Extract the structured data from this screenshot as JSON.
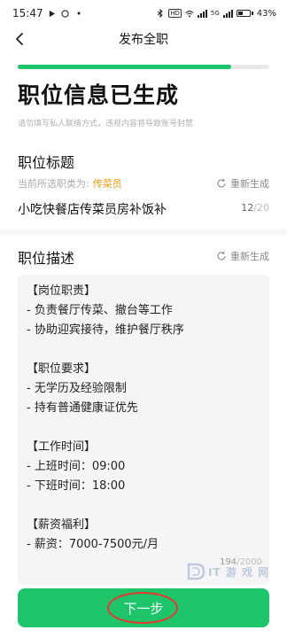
{
  "status_bar": {
    "time": "15:47",
    "network_badge_1": "HD",
    "network_badge_2": "5G",
    "battery": "43%"
  },
  "nav": {
    "title": "发布全职"
  },
  "progress": {
    "value": 0.85
  },
  "header": {
    "title": "职位信息已生成",
    "hint": "请勿填写私人联络方式，违规内容将导致账号封禁"
  },
  "job_title_section": {
    "heading": "职位标题",
    "regenerate_label": "重新生成",
    "category_prefix": "当前所选职类为:",
    "category_value": "传菜员",
    "title_value": "小吃快餐店传菜员房补饭补",
    "count_current": "12",
    "count_max": "/20"
  },
  "job_desc_section": {
    "heading": "职位描述",
    "regenerate_label": "重新生成",
    "lines": [
      "【岗位职责】",
      "- 负责餐厅传菜、撤台等工作",
      "- 协助迎宾接待，维护餐厅秩序",
      "",
      "【职位要求】",
      "- 无学历及经验限制",
      "- 持有普通健康证优先",
      "",
      "【工作时间】",
      "- 上班时间：09:00",
      "- 下班时间：18:00",
      "",
      "【薪资福利】",
      "- 薪资：7000-7500元/月"
    ],
    "count_current": "194",
    "count_max": "/2000"
  },
  "watermark": {
    "text": "IT 游 戏 网"
  },
  "footer": {
    "next_label": "下一步"
  },
  "colors": {
    "accent": "#1ec46a",
    "category": "#e59a16",
    "highlight_circle": "#e33333"
  }
}
